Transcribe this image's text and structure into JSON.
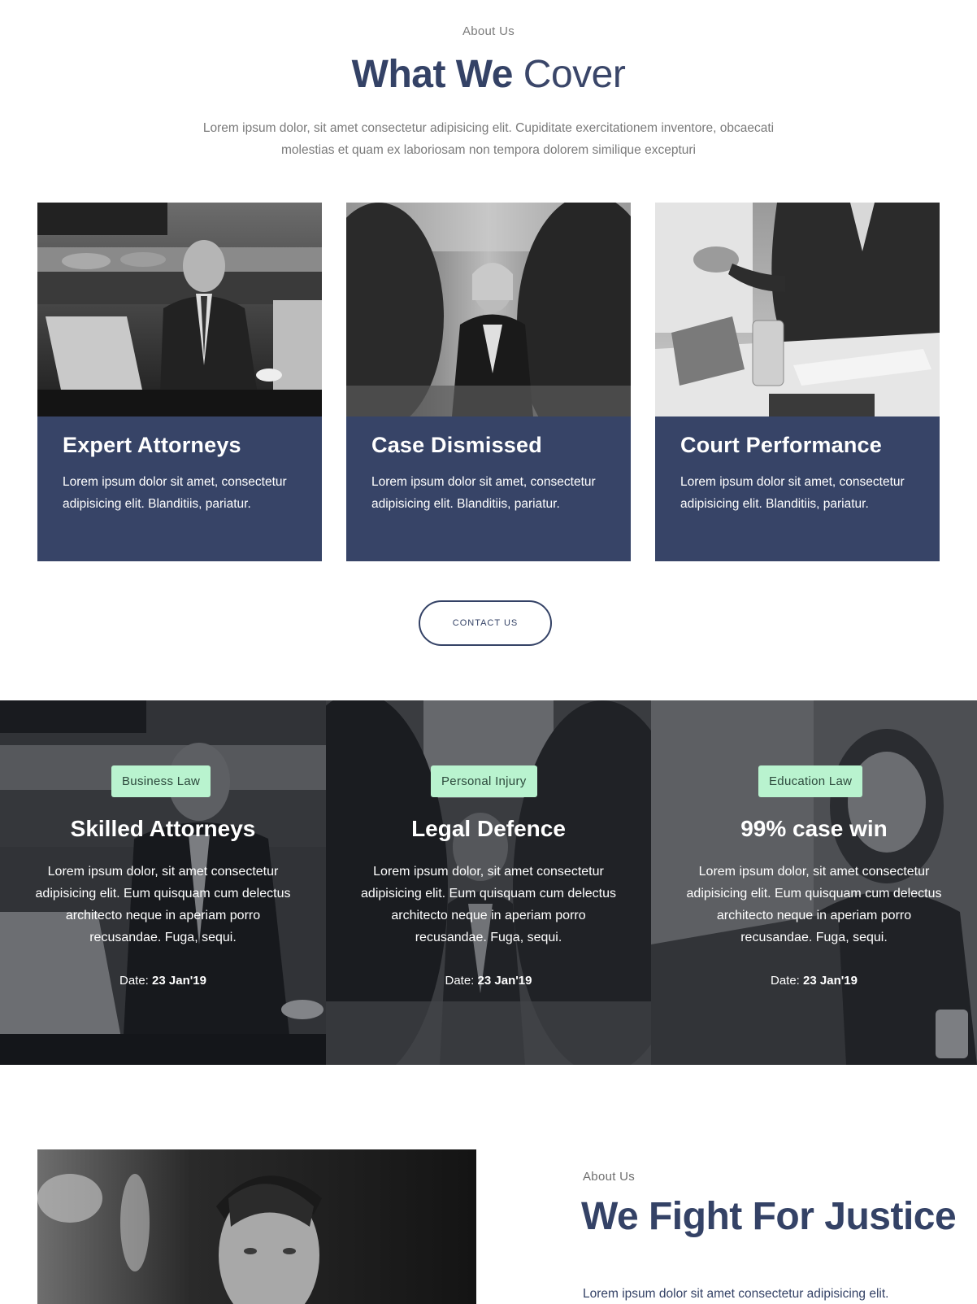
{
  "what_we_cover": {
    "eyebrow": "About Us",
    "title_bold": "What We",
    "title_light": "Cover",
    "lead": "Lorem ipsum dolor, sit amet consectetur adipisicing elit. Cupiditate exercitationem inventore, obcaecati molestias et quam ex laboriosam non tempora dolorem similique excepturi",
    "cards": [
      {
        "title": "Expert Attorneys",
        "text": "Lorem ipsum dolor sit amet, consectetur adipisicing elit. Blanditiis, pariatur."
      },
      {
        "title": "Case Dismissed",
        "text": "Lorem ipsum dolor sit amet, consectetur adipisicing elit. Blanditiis, pariatur."
      },
      {
        "title": "Court Performance",
        "text": "Lorem ipsum dolor sit amet, consectetur adipisicing elit. Blanditiis, pariatur."
      }
    ],
    "cta_label": "CONTACT US"
  },
  "services": [
    {
      "tag": "Business Law",
      "title": "Skilled Attorneys",
      "text": "Lorem ipsum dolor, sit amet consectetur adipisicing elit. Eum quisquam cum delectus architecto neque in aperiam porro recusandae. Fuga, sequi.",
      "date_label": "Date:",
      "date": "23 Jan'19"
    },
    {
      "tag": "Personal Injury",
      "title": "Legal Defence",
      "text": "Lorem ipsum dolor, sit amet consectetur adipisicing elit. Eum quisquam cum delectus architecto neque in aperiam porro recusandae. Fuga, sequi.",
      "date_label": "Date:",
      "date": "23 Jan'19"
    },
    {
      "tag": "Education Law",
      "title": "99% case win",
      "text": "Lorem ipsum dolor, sit amet consectetur adipisicing elit. Eum quisquam cum delectus architecto neque in aperiam porro recusandae. Fuga, sequi.",
      "date_label": "Date:",
      "date": "23 Jan'19"
    }
  ],
  "about": {
    "eyebrow": "About Us",
    "title_bold": "We Fight",
    "title_light": "For Justice",
    "lead": "Lorem ipsum dolor sit amet consectetur adipisicing elit."
  },
  "colors": {
    "navy": "#344266",
    "card_bg": "#374467",
    "tag_bg": "#b9f3cf"
  }
}
